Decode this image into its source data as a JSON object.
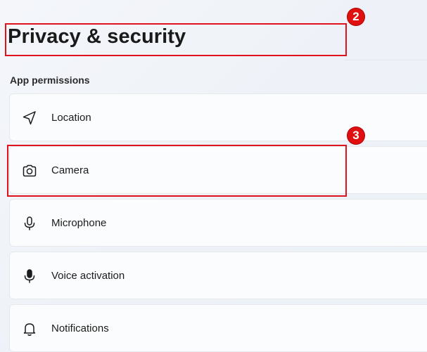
{
  "header": {
    "title": "Privacy & security"
  },
  "section": {
    "label": "App permissions"
  },
  "permissions": [
    {
      "label": "Location",
      "icon": "location-icon"
    },
    {
      "label": "Camera",
      "icon": "camera-icon"
    },
    {
      "label": "Microphone",
      "icon": "microphone-icon"
    },
    {
      "label": "Voice activation",
      "icon": "voice-activation-icon"
    },
    {
      "label": "Notifications",
      "icon": "notifications-icon"
    }
  ],
  "annotations": [
    {
      "number": "2",
      "target": "page-title"
    },
    {
      "number": "3",
      "target": "Camera"
    }
  ],
  "colors": {
    "annotation": "#e0121b",
    "card_background": "#fbfcfd",
    "card_border": "#e6e8eb"
  }
}
